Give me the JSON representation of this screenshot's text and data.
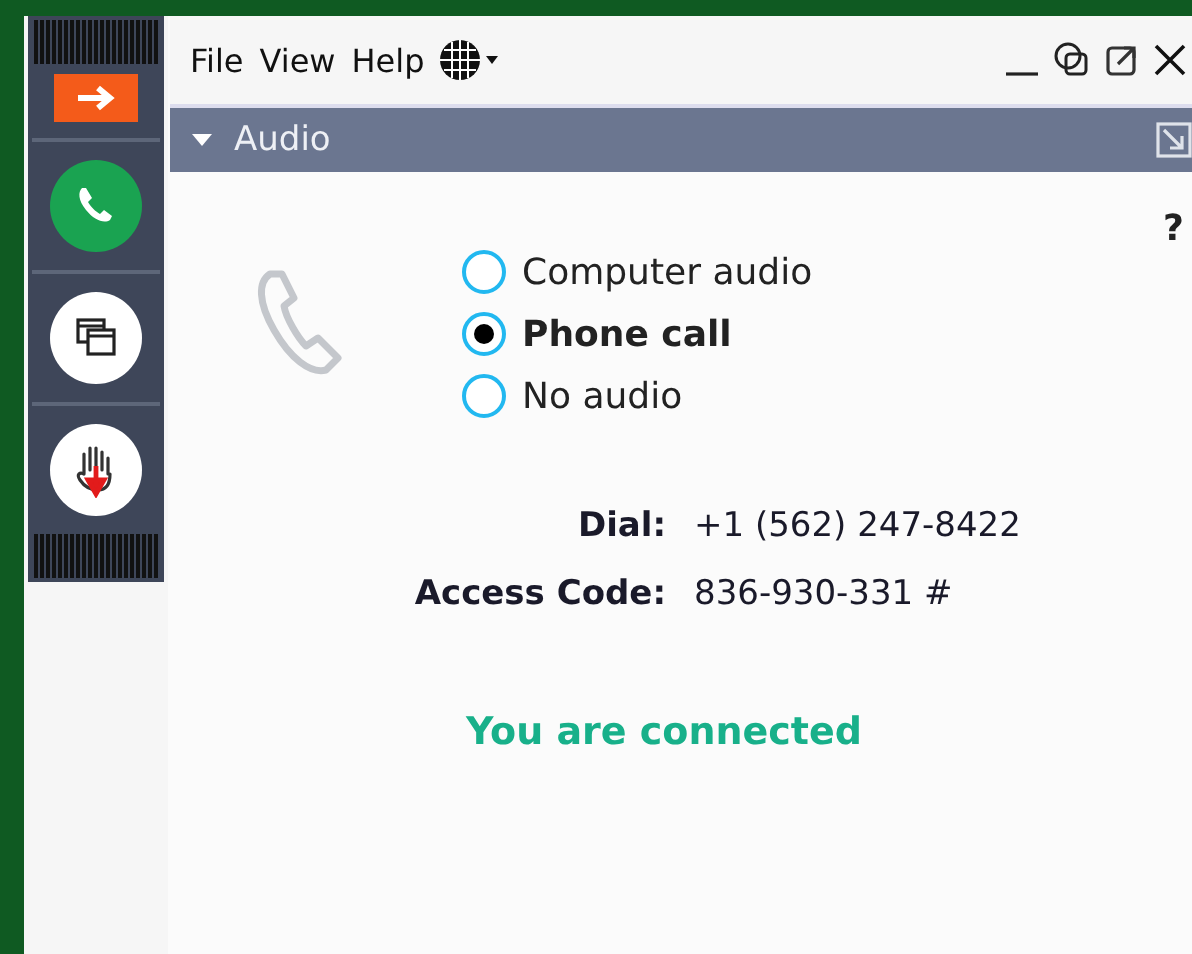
{
  "menu": [
    "File",
    "View",
    "Help"
  ],
  "panel": {
    "title": "Audio",
    "expanded": true,
    "help": "?"
  },
  "audio_options": [
    {
      "label": "Computer audio",
      "selected": false
    },
    {
      "label": "Phone call",
      "selected": true
    },
    {
      "label": "No audio",
      "selected": false
    }
  ],
  "dial_info": [
    {
      "label": "Dial:",
      "value": "+1 (562) 247-8422"
    },
    {
      "label": "Access Code:",
      "value": "836-930-331 #"
    }
  ],
  "status": "You are connected"
}
